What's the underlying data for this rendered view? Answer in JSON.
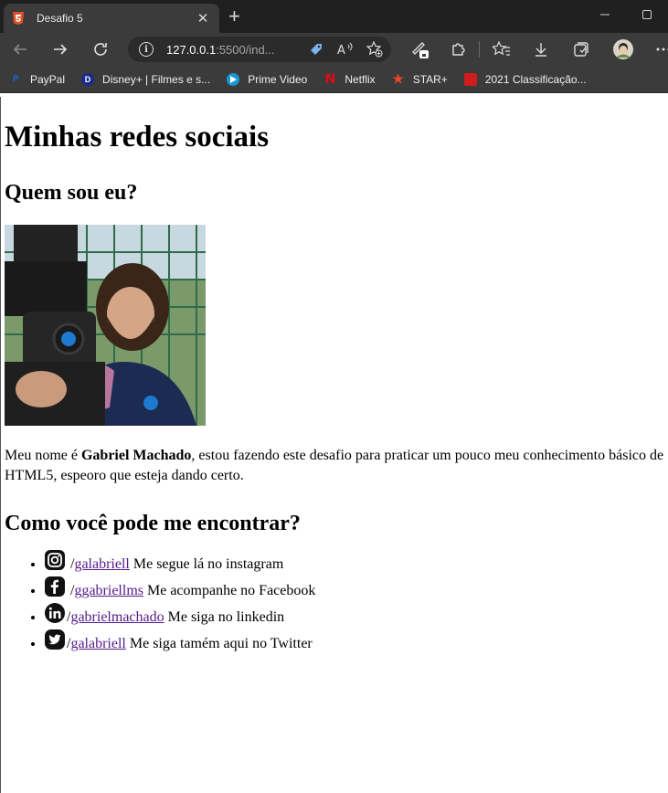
{
  "browser": {
    "tab_title": "Desafio 5",
    "tab_close": "✕",
    "new_tab": "+",
    "url_host": "127.0.0.1",
    "url_rest": ":5500/ind...",
    "bookmarks": [
      {
        "label": "PayPal",
        "icon": "paypal-icon",
        "color": "#1e66c7"
      },
      {
        "label": "Disney+ | Filmes e s...",
        "icon": "disney-icon",
        "color": "#1a2a8a"
      },
      {
        "label": "Prime Video",
        "icon": "prime-video-icon",
        "color": "#1a98d5"
      },
      {
        "label": "Netflix",
        "icon": "netflix-icon",
        "color": "#e50914"
      },
      {
        "label": "STAR+",
        "icon": "star-icon",
        "color": "#e8452c"
      },
      {
        "label": "2021 Classificação...",
        "icon": "folder-icon",
        "color": "#d01c1c"
      }
    ]
  },
  "page": {
    "heading": "Minhas redes sociais",
    "about_heading": "Quem sou eu?",
    "bio": {
      "before": "Meu nome é ",
      "name": "Gabriel Machado",
      "after": ", estou fazendo este desafio para praticar um pouco meu conhecimento básico de HTML5, espeoro que esteja dando certo."
    },
    "contact_heading": "Como você pode me encontrar?",
    "social": [
      {
        "icon": "instagram-icon",
        "prefix": " /",
        "handle": "galabriell",
        "text": " Me segue lá no instagram"
      },
      {
        "icon": "facebook-icon",
        "prefix": " /",
        "handle": "ggabriellms",
        "text": " Me acompanhe no Facebook"
      },
      {
        "icon": "linkedin-icon",
        "prefix": "/",
        "handle": "gabrielmachado",
        "text": " Me siga no linkedin"
      },
      {
        "icon": "twitter-icon",
        "prefix": "/",
        "handle": "galabriell",
        "text": " Me siga tamém aqui no Twitter"
      }
    ]
  }
}
